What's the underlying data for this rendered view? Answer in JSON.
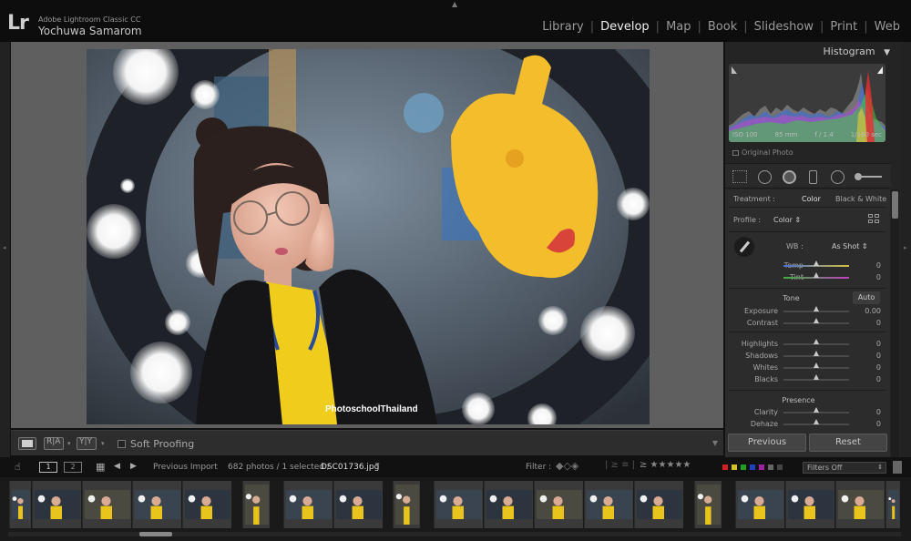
{
  "app": {
    "logo": "Lr",
    "name": "Adobe Lightroom Classic CC",
    "user": "Yochuwa Samarom"
  },
  "modules": [
    {
      "label": "Library",
      "active": false
    },
    {
      "label": "Develop",
      "active": true
    },
    {
      "label": "Map",
      "active": false
    },
    {
      "label": "Book",
      "active": false
    },
    {
      "label": "Slideshow",
      "active": false
    },
    {
      "label": "Print",
      "active": false
    },
    {
      "label": "Web",
      "active": false
    }
  ],
  "photo": {
    "watermark": "PhotoschoolThailand"
  },
  "toolbar": {
    "soft_proofing": "Soft Proofing"
  },
  "histogram": {
    "title": "Histogram",
    "iso": "ISO 100",
    "focal": "85 mm",
    "aperture": "f / 1.4",
    "shutter": "1/160 sec",
    "original_photo": "Original Photo"
  },
  "basic": {
    "treatment_label": "Treatment :",
    "treatment_color": "Color",
    "treatment_bw": "Black & White",
    "profile_label": "Profile :",
    "profile_value": "Color",
    "wb_label": "WB :",
    "wb_value": "As Shot",
    "tone_label": "Tone",
    "auto_label": "Auto",
    "presence_label": "Presence",
    "sliders": [
      {
        "label": "Temp",
        "value": "0"
      },
      {
        "label": "Tint",
        "value": "0"
      },
      {
        "label": "Exposure",
        "value": "0.00"
      },
      {
        "label": "Contrast",
        "value": "0"
      },
      {
        "label": "Highlights",
        "value": "0"
      },
      {
        "label": "Shadows",
        "value": "0"
      },
      {
        "label": "Whites",
        "value": "0"
      },
      {
        "label": "Blacks",
        "value": "0"
      },
      {
        "label": "Clarity",
        "value": "0"
      },
      {
        "label": "Dehaze",
        "value": "0"
      }
    ]
  },
  "buttons": {
    "previous": "Previous",
    "reset": "Reset"
  },
  "filmstrip": {
    "view1": "1",
    "view2": "2",
    "source": "Previous Import",
    "count": "682 photos / 1 selected /",
    "filename": "DSC01736.jpg",
    "filter_label": "Filter :",
    "filters_off": "Filters Off"
  },
  "colors": {
    "accent_yellow": "#f5c518",
    "panel_bg": "#2c2c2c",
    "canvas_bg": "#5f5f5f"
  }
}
